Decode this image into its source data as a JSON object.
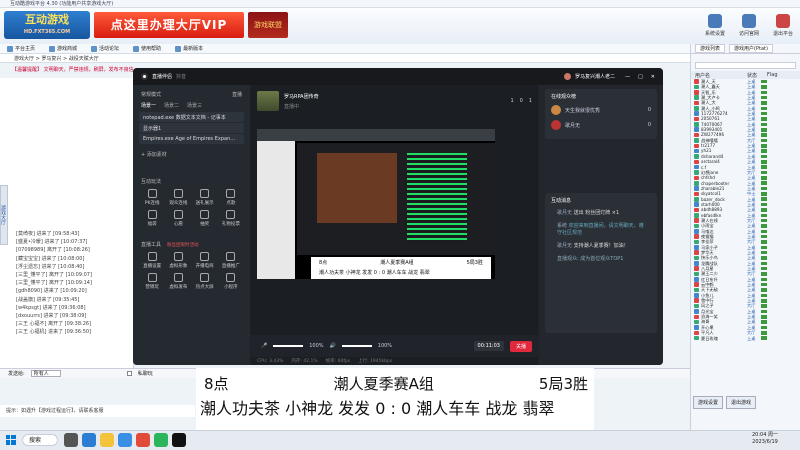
{
  "window": {
    "title": "互动酷游戏平台 4.30 (功能用户共享游戏大厅)"
  },
  "logo": {
    "text": "互动游戏",
    "sub": "HD.FXT365.COM"
  },
  "banner": {
    "vip": "点这里办理大厅VIP",
    "shield": "游戏联盟"
  },
  "topbuttons": [
    {
      "label": "系统设置"
    },
    {
      "label": "访问官网"
    },
    {
      "label": "退出平台"
    }
  ],
  "toolbar": [
    {
      "label": "平台主页"
    },
    {
      "label": "游戏商城"
    },
    {
      "label": "活动论坛"
    },
    {
      "label": "使用帮助"
    },
    {
      "label": "最新版本"
    }
  ],
  "address": {
    "path": "游戏大厅 > 罗马复兴 > 战役天赋大厅"
  },
  "marquee": "【温馨提醒】 文明聊天，严禁违规，刷屏，发布不良信息",
  "sidetab": "游戏大厅",
  "messages": [
    "[莫绮夜] 进来了 [09:58:43]",
    "[盛夏•冷暖] 进来了 [10:07:37]",
    "[07098989] 离开了 [10:08:26]",
    "[藏宝宝宝] 进来了 [10:08:00]",
    "[浮尘遗忘] 进来了 [10:08:40]",
    "[三里_懂平了] 离开了 [10:09:07]",
    "[三里_懂平了] 离开了 [10:09:14]",
    "[gdh8090] 进来了 [10:09:20]",
    "[战盖旗] 进来了 [09:35:45]",
    "[w4kpsgt] 进来了 [09:36:08]",
    "[dxouurrs] 进来了 [09:38:09]",
    "[三王 心福不] 离开了 [09:38:26]",
    "[三王 心福机] 进来了 [09:36:50]"
  ],
  "chatbottom": {
    "label": "发送给:",
    "selected": "所有人",
    "check": "私聊玩"
  },
  "hint": "提示：如遇升【游戏过程运行】，请联系客服",
  "rpanel": {
    "tabs": [
      "游戏列表",
      "游戏用户(Ptat)"
    ],
    "header": {
      "name": "用户名",
      "status": "状态",
      "flag": "Flag"
    },
    "users": [
      {
        "name": "潮人_天",
        "status": "上桌",
        "c": "#d44"
      },
      {
        "name": "潮人_鑫天",
        "status": "上桌",
        "c": "#3a7"
      },
      {
        "name": "天智_乐",
        "status": "上桌",
        "c": "#d44"
      },
      {
        "name": "潮_大卢卡",
        "status": "上桌",
        "c": "#3a7"
      },
      {
        "name": "潮人_大",
        "status": "上桌",
        "c": "#d44"
      },
      {
        "name": "潮人_小鸣",
        "status": "上桌",
        "c": "#3a7"
      },
      {
        "name": "1172776274",
        "status": "上桌",
        "c": "#48c"
      },
      {
        "name": "2050761",
        "status": "上桌",
        "c": "#d44"
      },
      {
        "name": "74070067",
        "status": "上桌",
        "c": "#3a7"
      },
      {
        "name": "83993401",
        "status": "上桌",
        "c": "#48c"
      },
      {
        "name": "ZW277496",
        "status": "上桌",
        "c": "#d44"
      },
      {
        "name": "战神嘻嘻",
        "status": "大厅",
        "c": "#3a7"
      },
      {
        "name": "tr2177",
        "status": "上桌",
        "c": "#d44"
      },
      {
        "name": "yh21",
        "status": "上桌",
        "c": "#48c"
      },
      {
        "name": "dsharand4",
        "status": "上桌",
        "c": "#3a7"
      },
      {
        "name": "arctaral4",
        "status": "上桌",
        "c": "#d44"
      },
      {
        "name": "c.f",
        "status": "上桌",
        "c": "#48c"
      },
      {
        "name": "幻想jane",
        "status": "大厅",
        "c": "#3a7"
      },
      {
        "name": "chfshd",
        "status": "上桌",
        "c": "#d44"
      },
      {
        "name": "chaperbooter",
        "status": "上桌",
        "c": "#3a7"
      },
      {
        "name": "zharable21",
        "status": "上桌",
        "c": "#48c"
      },
      {
        "name": "skyatcol1",
        "status": "中士",
        "c": "#d44"
      },
      {
        "name": "bazer_dock",
        "status": "上桌",
        "c": "#3a7"
      },
      {
        "name": "starh000",
        "status": "上桌",
        "c": "#48c"
      },
      {
        "name": "abdh8893",
        "status": "上桌",
        "c": "#d44"
      },
      {
        "name": "ebfasdlkn",
        "status": "上桌",
        "c": "#3a7"
      },
      {
        "name": "潮人在线",
        "status": "大厅",
        "c": "#d44"
      },
      {
        "name": "小雨宝",
        "status": "上桌",
        "c": "#3a7"
      },
      {
        "name": "马喰达",
        "status": "上桌",
        "c": "#48c"
      },
      {
        "name": "夜猫猫",
        "status": "上桌",
        "c": "#d44"
      },
      {
        "name": "李佳菲",
        "status": "大厅",
        "c": "#3a7"
      },
      {
        "name": "马家小子",
        "status": "上桌",
        "c": "#48c"
      },
      {
        "name": "梦华天",
        "status": "上桌",
        "c": "#d44"
      },
      {
        "name": "快乐小鸟",
        "status": "上桌",
        "c": "#3a7"
      },
      {
        "name": "龙腾战队",
        "status": "上桌",
        "c": "#48c"
      },
      {
        "name": "八月星",
        "status": "上桌",
        "c": "#d44"
      },
      {
        "name": "潮王二少",
        "status": "大厅",
        "c": "#3a7"
      },
      {
        "name": "红日东升",
        "status": "上桌",
        "c": "#48c"
      },
      {
        "name": "云中鹤",
        "status": "上桌",
        "c": "#d44"
      },
      {
        "name": "天下无敌",
        "status": "上桌",
        "c": "#3a7"
      },
      {
        "name": "小鱼儿",
        "status": "上桌",
        "c": "#48c"
      },
      {
        "name": "雪中行",
        "status": "上桌",
        "c": "#d44"
      },
      {
        "name": "风之子",
        "status": "大厅",
        "c": "#3a7"
      },
      {
        "name": "月光宝",
        "status": "上桌",
        "c": "#48c"
      },
      {
        "name": "沧海一笑",
        "status": "上桌",
        "c": "#d44"
      },
      {
        "name": "海哥",
        "status": "上桌",
        "c": "#3a7"
      },
      {
        "name": "开心果",
        "status": "上桌",
        "c": "#48c"
      },
      {
        "name": "平凡人",
        "status": "大厅",
        "c": "#d44"
      },
      {
        "name": "夏日玫瑰",
        "status": "上桌",
        "c": "#3a7"
      }
    ],
    "buttons": [
      "游戏设置",
      "退出游戏"
    ]
  },
  "live": {
    "app": "直播伴侣",
    "appsub": "抖音",
    "user": "罗马复兴潮人老二",
    "sidebar": {
      "mode": "常规模式",
      "live": "直播",
      "scenes": [
        "场景一",
        "场景二",
        "场景三"
      ],
      "sources": [
        "notepad.exe 数据文本文档 - 记事本",
        "显示器1",
        "Empires.exe Age of Empires Expan..."
      ],
      "add": "添加素材",
      "interact": "互动玩法",
      "interact_items": [
        "PK连线",
        "观众连线",
        "送礼展示",
        "点歌",
        "福袋",
        "心愿",
        "抽奖",
        "礼物投票"
      ],
      "tools": "直播工具",
      "tools_badge": "粉丝团限时活动",
      "tool_items": [
        "直播设置",
        "虚拟形象",
        "开播电商",
        "直播推广",
        "营销玩",
        "虚拟发布",
        "热点大屏",
        "小程序"
      ]
    },
    "stream": {
      "title": "罗马RPA团传奇",
      "tag": "直播中",
      "counts": [
        "1",
        "0",
        "1"
      ]
    },
    "preview_caption": {
      "l1a": "8点",
      "l1b": "潮人夏季赛A组",
      "l1c": "5局3胜",
      "l2": "潮人功夫茶 小神龙 发发 0 : 0 潮人车车 战龙 翡翠"
    },
    "controls": {
      "mic": "100%",
      "spk": "100%",
      "timer": "00:11:03",
      "end": "关播"
    },
    "status": {
      "cpu": "CPU: 3.43%",
      "mem": "内存: 42.1%",
      "fps": "帧率: 60fps",
      "bitrate": "上行: 1945kbps"
    },
    "right": {
      "rank_title": "在线观众榜",
      "ranks": [
        {
          "name": "天生我就很优秀",
          "score": "0"
        },
        {
          "name": "歌月无",
          "score": "0"
        }
      ],
      "msg_title": "互动消息",
      "msgs": [
        {
          "n": "歌月无",
          "t": "送出 粉丝团灯牌 ×1"
        },
        {
          "n": "系统",
          "t": "欢迎来到直播间，请文明聊天，遵守社区规范"
        },
        {
          "n": "歌月无",
          "t": "支持潮人夏季赛！加油！"
        }
      ],
      "footer": "直播观众: 成为首位观众TOP1"
    }
  },
  "subtitle": {
    "line1a": "8点",
    "line1b": "潮人夏季赛A组",
    "line1c": "5局3胜",
    "line2": "潮人功夫茶 小神龙 发发 0 :  0 潮人车车 战龙 翡翠"
  },
  "taskbar": {
    "search": "搜索",
    "time": "20:04 周一",
    "date": "2023/6/19"
  }
}
